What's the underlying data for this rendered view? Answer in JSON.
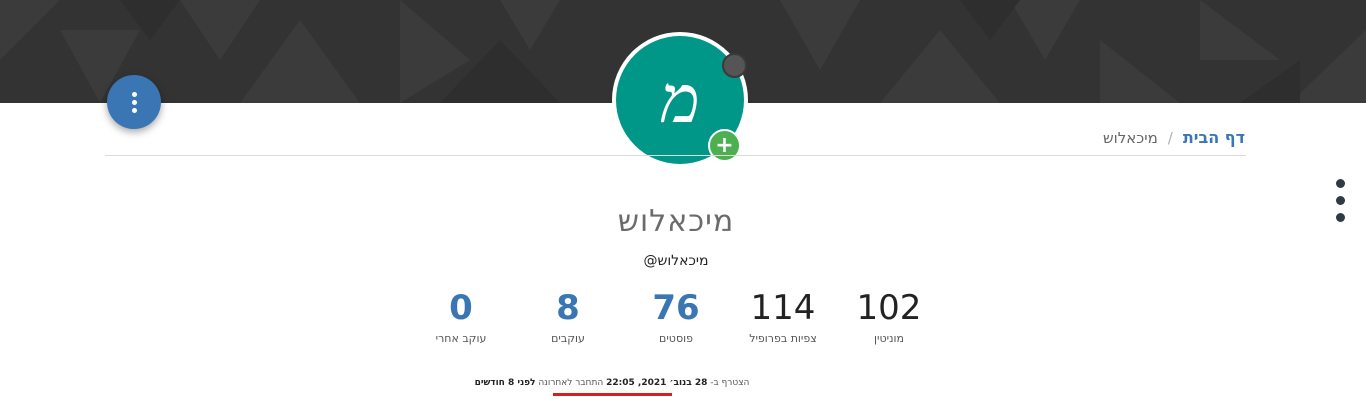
{
  "colors": {
    "cover": "#333333",
    "accent": "#3a76b4",
    "avatar_bg": "#009688",
    "add_button": "#4caf50",
    "status_offline": "#555555",
    "highlight_underline": "#d62020"
  },
  "avatar": {
    "letter": "מ",
    "add_icon": "+"
  },
  "breadcrumb": {
    "home": "דף הבית",
    "separator": "/",
    "current": "מיכאלוש"
  },
  "profile": {
    "display_name": "מיכאלוש",
    "username": "@מיכאלוש"
  },
  "stats": {
    "reputation": {
      "value": "102",
      "label": "מוניטין"
    },
    "profile_views": {
      "value": "114",
      "label": "צפיות בפרופיל"
    },
    "posts": {
      "value": "76",
      "label": "פוסטים"
    },
    "followers": {
      "value": "8",
      "label": "עוקבים"
    },
    "following": {
      "value": "0",
      "label": "עוקב אחרי"
    }
  },
  "info": {
    "joined_prefix": "הצטרף ב-",
    "joined_date": "28 בנוב׳ 2021, 22:05",
    "last_seen_prefix": "התחבר לאחרונה",
    "last_seen": "לפני 8 חודשים"
  },
  "icons": {
    "options": "vertical-dots-icon",
    "side_menu": "vertical-dots-icon",
    "add_photo": "plus-icon",
    "status": "status-dot-icon"
  }
}
